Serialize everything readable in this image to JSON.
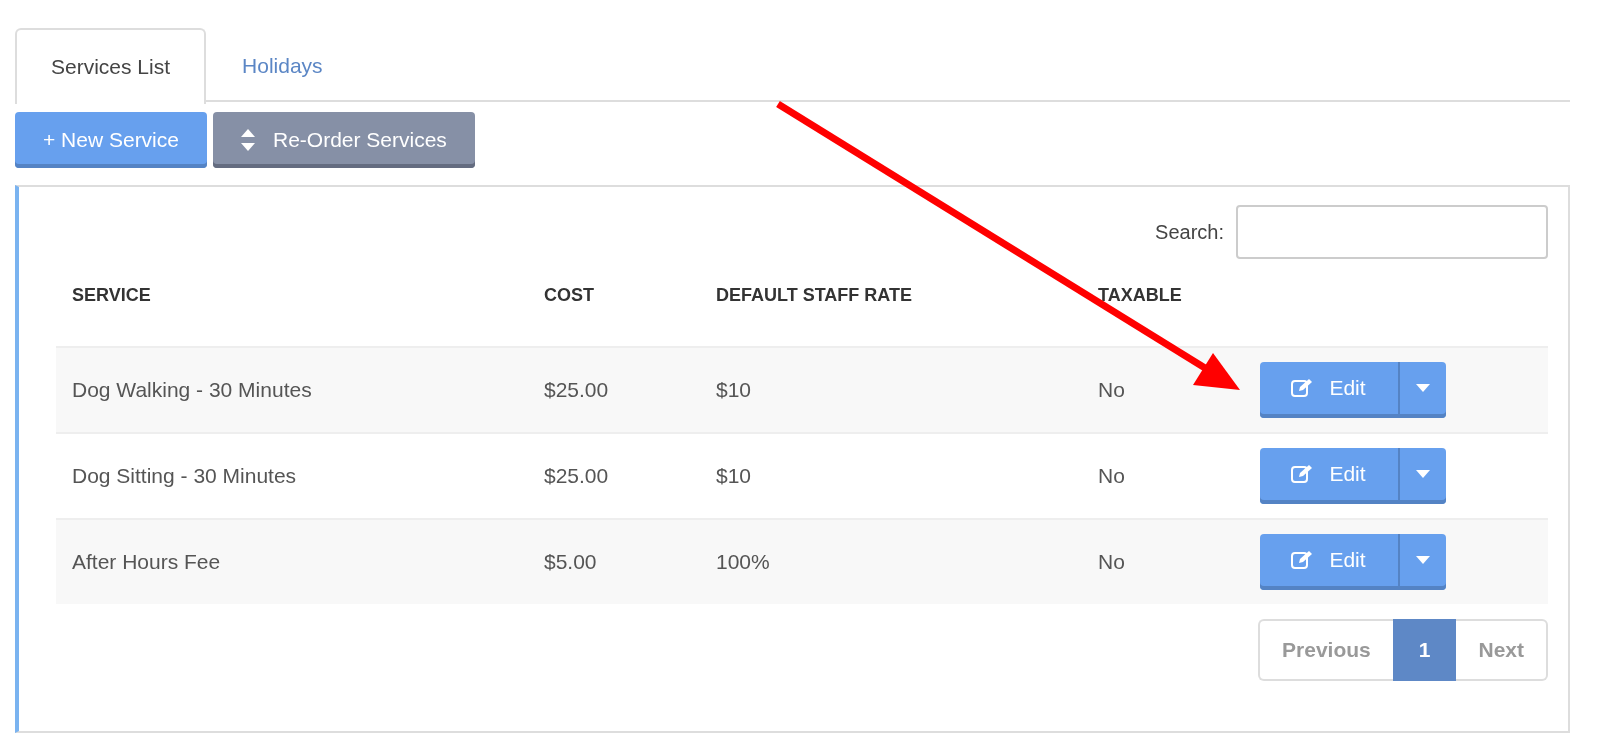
{
  "tabs": [
    {
      "label": "Services List",
      "selected": true
    },
    {
      "label": "Holidays",
      "selected": false
    }
  ],
  "actions": [
    {
      "label": "+ New Service",
      "kind": "primary"
    },
    {
      "label": "Re-Order Services",
      "kind": "sort"
    }
  ],
  "search": {
    "label": "Search:"
  },
  "table": {
    "columns": [
      "SERVICE",
      "COST",
      "DEFAULT STAFF RATE",
      "TAXABLE"
    ],
    "rows": [
      {
        "cells": [
          "Dog Walking - 30 Minutes",
          "$25.00",
          "$10",
          "No"
        ],
        "action": "Edit"
      },
      {
        "cells": [
          "Dog Sitting - 30 Minutes",
          "$25.00",
          "$10",
          "No"
        ],
        "action": "Edit"
      },
      {
        "cells": [
          "After Hours Fee",
          "$5.00",
          "100%",
          "No"
        ],
        "action": "Edit"
      }
    ]
  },
  "pagination": {
    "previous": "Previous",
    "pages": [
      {
        "label": "1",
        "selected": true
      }
    ],
    "next": "Next"
  }
}
